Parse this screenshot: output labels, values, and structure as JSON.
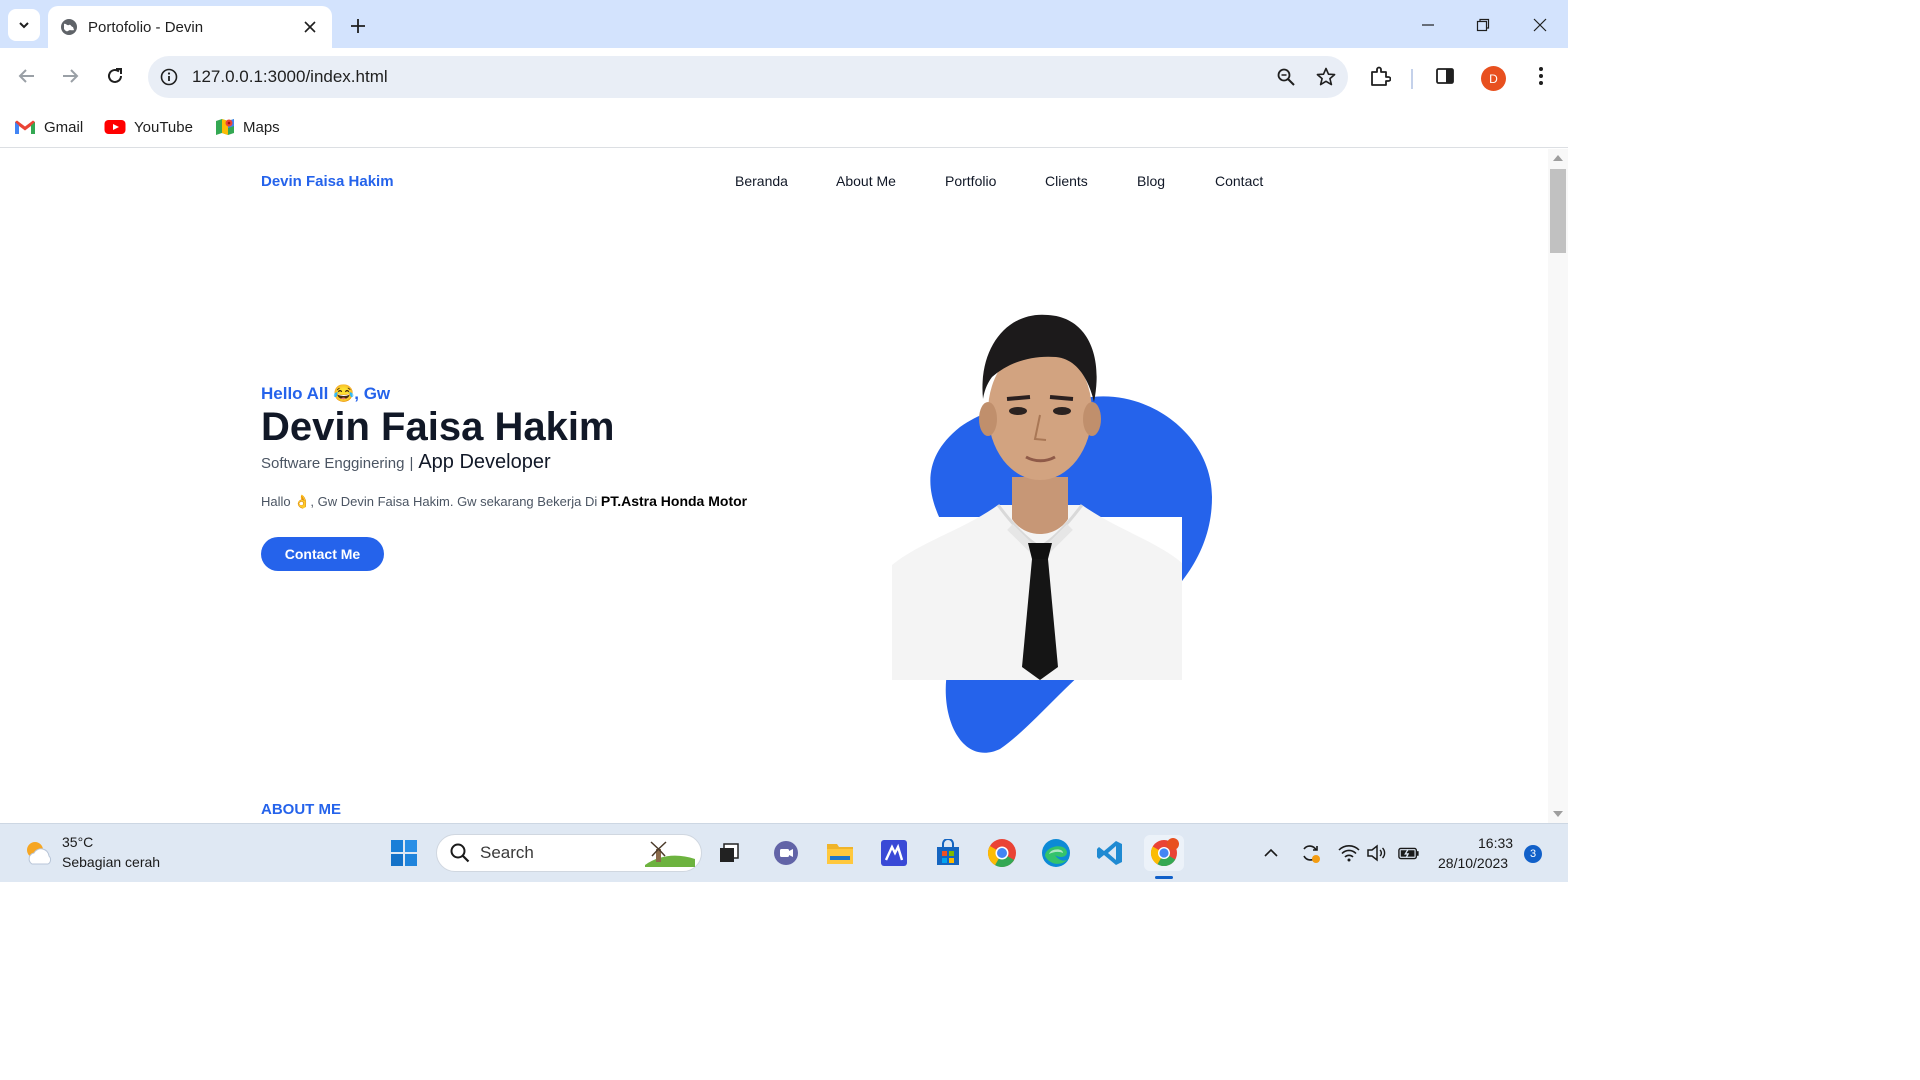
{
  "browser": {
    "tab_title": "Portofolio - Devin",
    "url": "127.0.0.1:3000/index.html",
    "profile_initial": "D",
    "bookmarks": [
      {
        "label": "Gmail",
        "icon": "gmail-icon"
      },
      {
        "label": "YouTube",
        "icon": "youtube-icon"
      },
      {
        "label": "Maps",
        "icon": "maps-icon"
      }
    ]
  },
  "site": {
    "brand": "Devin Faisa Hakim",
    "nav": [
      "Beranda",
      "About Me",
      "Portfolio",
      "Clients",
      "Blog",
      "Contact"
    ],
    "hero": {
      "greeting": "Hello All 😂, Gw",
      "name": "Devin Faisa Hakim",
      "role_primary": "Software Engginering",
      "role_separator": "|",
      "role_secondary": "App Developer",
      "intro_text": "Hallo 👌, Gw Devin Faisa Hakim. Gw sekarang Bekerja Di",
      "intro_company": "PT.Astra Honda Motor",
      "cta_label": "Contact Me"
    },
    "about_heading": "ABOUT ME",
    "accent_color": "#2563eb"
  },
  "taskbar": {
    "weather_temp": "35°C",
    "weather_desc": "Sebagian cerah",
    "search_label": "Search",
    "time": "16:33",
    "date": "28/10/2023",
    "notification_count": "3"
  }
}
